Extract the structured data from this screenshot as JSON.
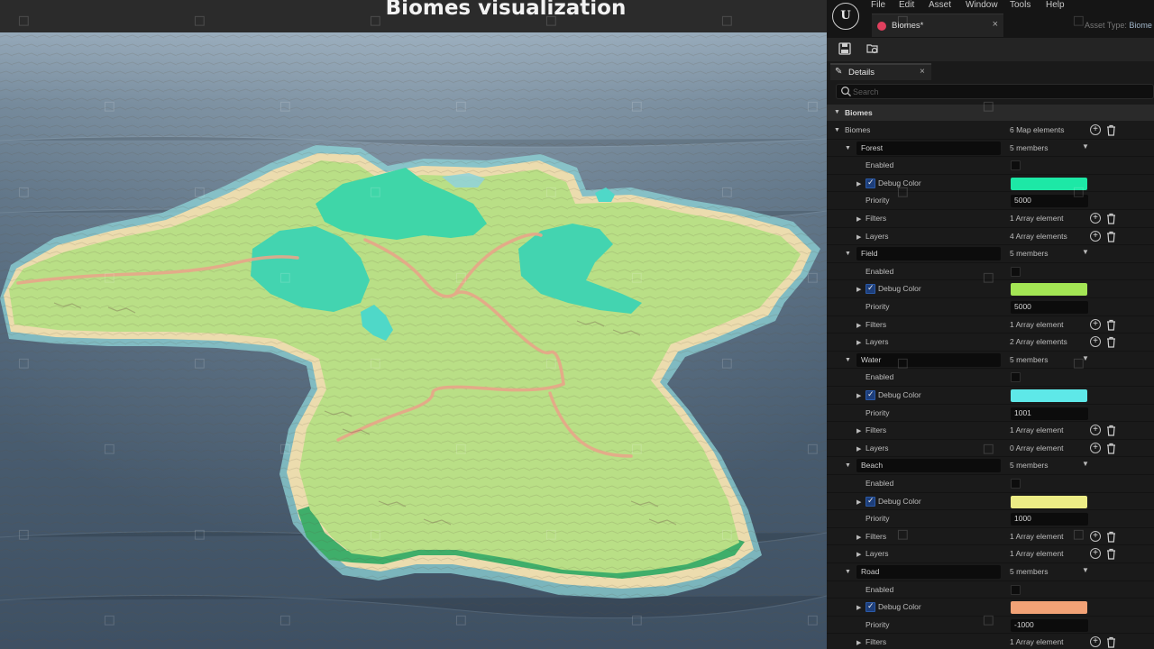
{
  "viewport": {
    "title": "Biomes visualization"
  },
  "editor": {
    "logo": "U",
    "menu": [
      "File",
      "Edit",
      "Asset",
      "Window",
      "Tools",
      "Help"
    ],
    "tab": {
      "label": "Biomes*",
      "close": "×"
    },
    "asset_type_label": "Asset Type:",
    "asset_type_value": "Biome",
    "toolbar_icons": [
      "save-icon",
      "browse-icon"
    ],
    "details": {
      "icon": "pencil-icon",
      "label": "Details",
      "close": "×"
    },
    "search": {
      "placeholder": "Search"
    },
    "category": {
      "label": "Biomes"
    },
    "map_row": {
      "label": "Biomes",
      "value": "6 Map elements"
    },
    "labels": {
      "enabled": "Enabled",
      "debug_color": "Debug Color",
      "priority": "Priority",
      "filters": "Filters",
      "layers": "Layers"
    },
    "biomes": [
      {
        "name": "Forest",
        "members": "5 members",
        "enabled": false,
        "debug_color_checked": true,
        "color": "#1de8a6",
        "priority": "5000",
        "filters": "1 Array element",
        "layers": "4 Array elements"
      },
      {
        "name": "Field",
        "members": "5 members",
        "enabled": false,
        "debug_color_checked": true,
        "color": "#a3e554",
        "priority": "5000",
        "filters": "1 Array element",
        "layers": "2 Array elements"
      },
      {
        "name": "Water",
        "members": "5 members",
        "enabled": false,
        "debug_color_checked": true,
        "color": "#5ee8e8",
        "priority": "1001",
        "filters": "1 Array element",
        "layers": "0 Array element"
      },
      {
        "name": "Beach",
        "members": "5 members",
        "enabled": false,
        "debug_color_checked": true,
        "color": "#ecec85",
        "priority": "1000",
        "filters": "1 Array element",
        "layers": "1 Array element"
      },
      {
        "name": "Road",
        "members": "5 members",
        "enabled": false,
        "debug_color_checked": true,
        "color": "#f2a276",
        "priority": "-1000",
        "filters": "1 Array element",
        "layers": ""
      }
    ]
  }
}
